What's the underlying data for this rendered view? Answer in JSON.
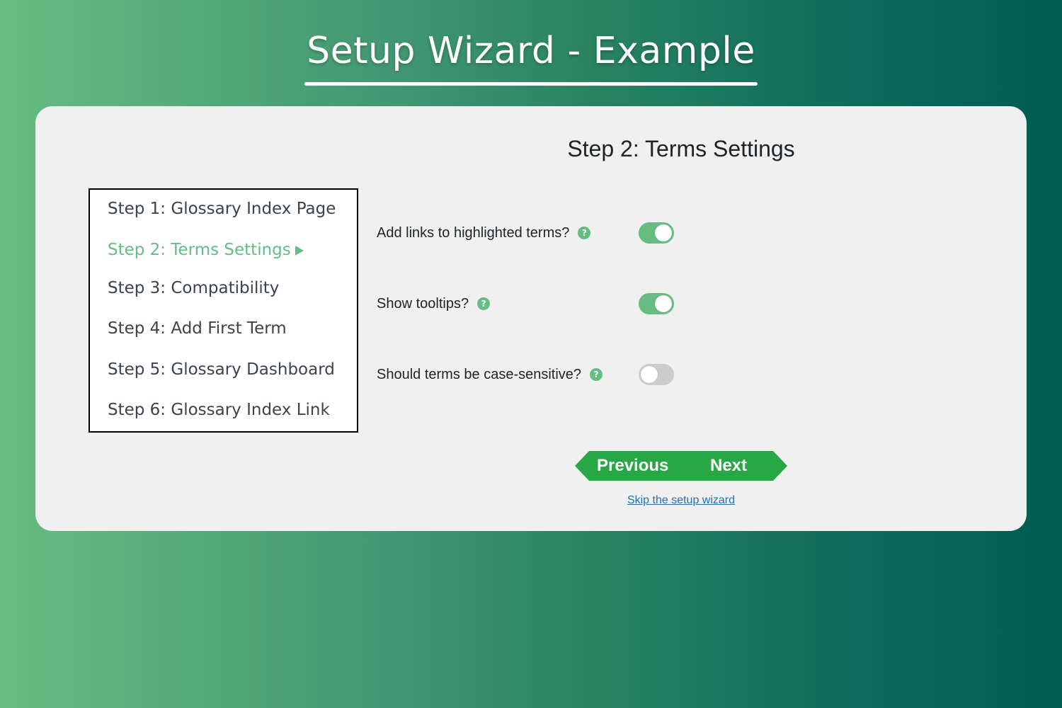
{
  "header": {
    "title": "Setup Wizard - Example"
  },
  "main": {
    "step_heading": "Step 2: Terms Settings",
    "steps": [
      {
        "label": "Step 1: Glossary Index Page",
        "active": false
      },
      {
        "label": "Step 2: Terms Settings",
        "active": true
      },
      {
        "label": "Step 3: Compatibility",
        "active": false
      },
      {
        "label": "Step 4: Add First Term",
        "active": false
      },
      {
        "label": "Step 5: Glossary Dashboard",
        "active": false
      },
      {
        "label": "Step 6: Glossary Index Link",
        "active": false
      }
    ],
    "options": [
      {
        "label": "Add links to highlighted terms?",
        "help_icon": "question-circle-icon",
        "enabled": true
      },
      {
        "label": "Show tooltips?",
        "help_icon": "question-circle-icon",
        "enabled": true
      },
      {
        "label": "Should terms be case-sensitive?",
        "help_icon": "question-circle-icon",
        "enabled": false
      }
    ],
    "help_glyph": "?",
    "buttons": {
      "previous_label": "Previous",
      "next_label": "Next"
    },
    "skip_link": "Skip the setup wizard"
  },
  "colors": {
    "accent": "#66bd82",
    "button_green": "#28a745",
    "toggle_off": "#cccccc",
    "link": "#2271b1",
    "gradient_start": "#66bd82",
    "gradient_end": "#005c51"
  }
}
